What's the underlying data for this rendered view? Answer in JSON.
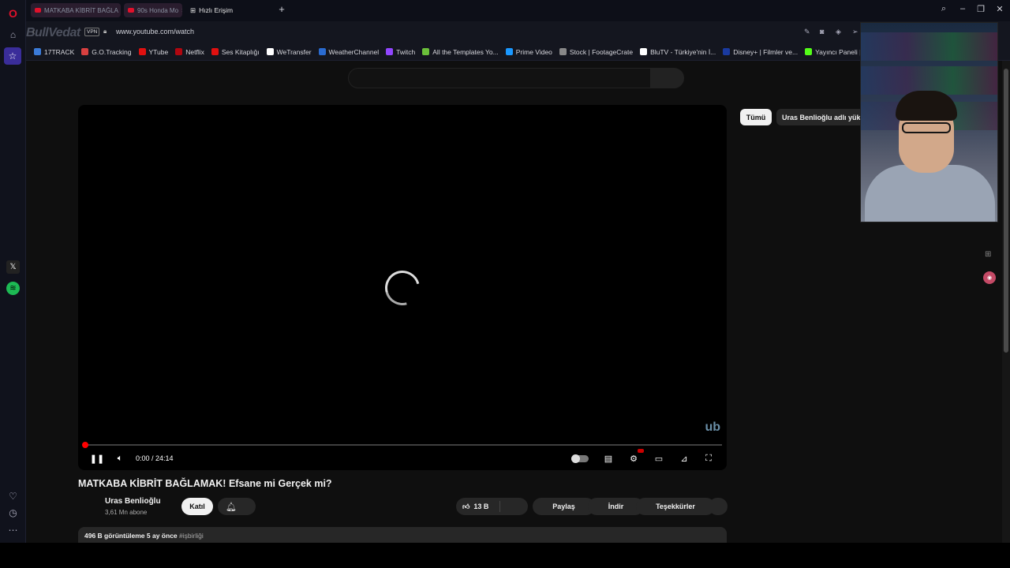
{
  "browser": {
    "tabs": [
      {
        "label": "MATKABA KİBRİT BAĞLA"
      },
      {
        "label": "90s Honda Mo"
      },
      {
        "label": "Hızlı Erişim"
      }
    ],
    "new_tab_symbol": "+",
    "url": "www.youtube.com/watch",
    "vpn_label": "VPN",
    "watermark": "BullVedat",
    "bookmarks": [
      {
        "label": "17TRACK",
        "color": "#3b7bd8"
      },
      {
        "label": "G.O.Tracking",
        "color": "#d84040"
      },
      {
        "label": "YTube",
        "color": "#e01010"
      },
      {
        "label": "Netflix",
        "color": "#b00710"
      },
      {
        "label": "Ses Kitaplığı",
        "color": "#e01010"
      },
      {
        "label": "WeTransfer",
        "color": "#ffffff"
      },
      {
        "label": "WeatherChannel",
        "color": "#2a6bd0"
      },
      {
        "label": "Twitch",
        "color": "#9146ff"
      },
      {
        "label": "All the Templates Yo...",
        "color": "#6bbf3a"
      },
      {
        "label": "Prime Video",
        "color": "#1a98ff"
      },
      {
        "label": "Stock | FootageCrate",
        "color": "#888888"
      },
      {
        "label": "BluTV - Türkiye'nin İ...",
        "color": "#ffffff"
      },
      {
        "label": "Disney+ | Filmler ve...",
        "color": "#1a3aa0"
      },
      {
        "label": "Yayıncı Paneli | Kick",
        "color": "#53fc18"
      }
    ]
  },
  "player": {
    "time": "0:00 / 24:14",
    "progress_fraction": 0.0,
    "watermark": "ub"
  },
  "video": {
    "title": "MATKABA KİBRİT BAĞLAMAK! Efsane mi Gerçek mi?",
    "channel": "Uras Benlioğlu",
    "subscribers": "3,61 Mn abone",
    "join_label": "Katıl",
    "likes": "13 B",
    "share_label": "Paylaş",
    "download_label": "İndir",
    "thanks_label": "Teşekkürler",
    "views": "496 B görüntüleme",
    "age": "5 ay önce",
    "hashtag": "#işbirliği"
  },
  "chips": {
    "all": "Tümü",
    "channel": "Uras Benlioğlu adlı yükleyici"
  }
}
